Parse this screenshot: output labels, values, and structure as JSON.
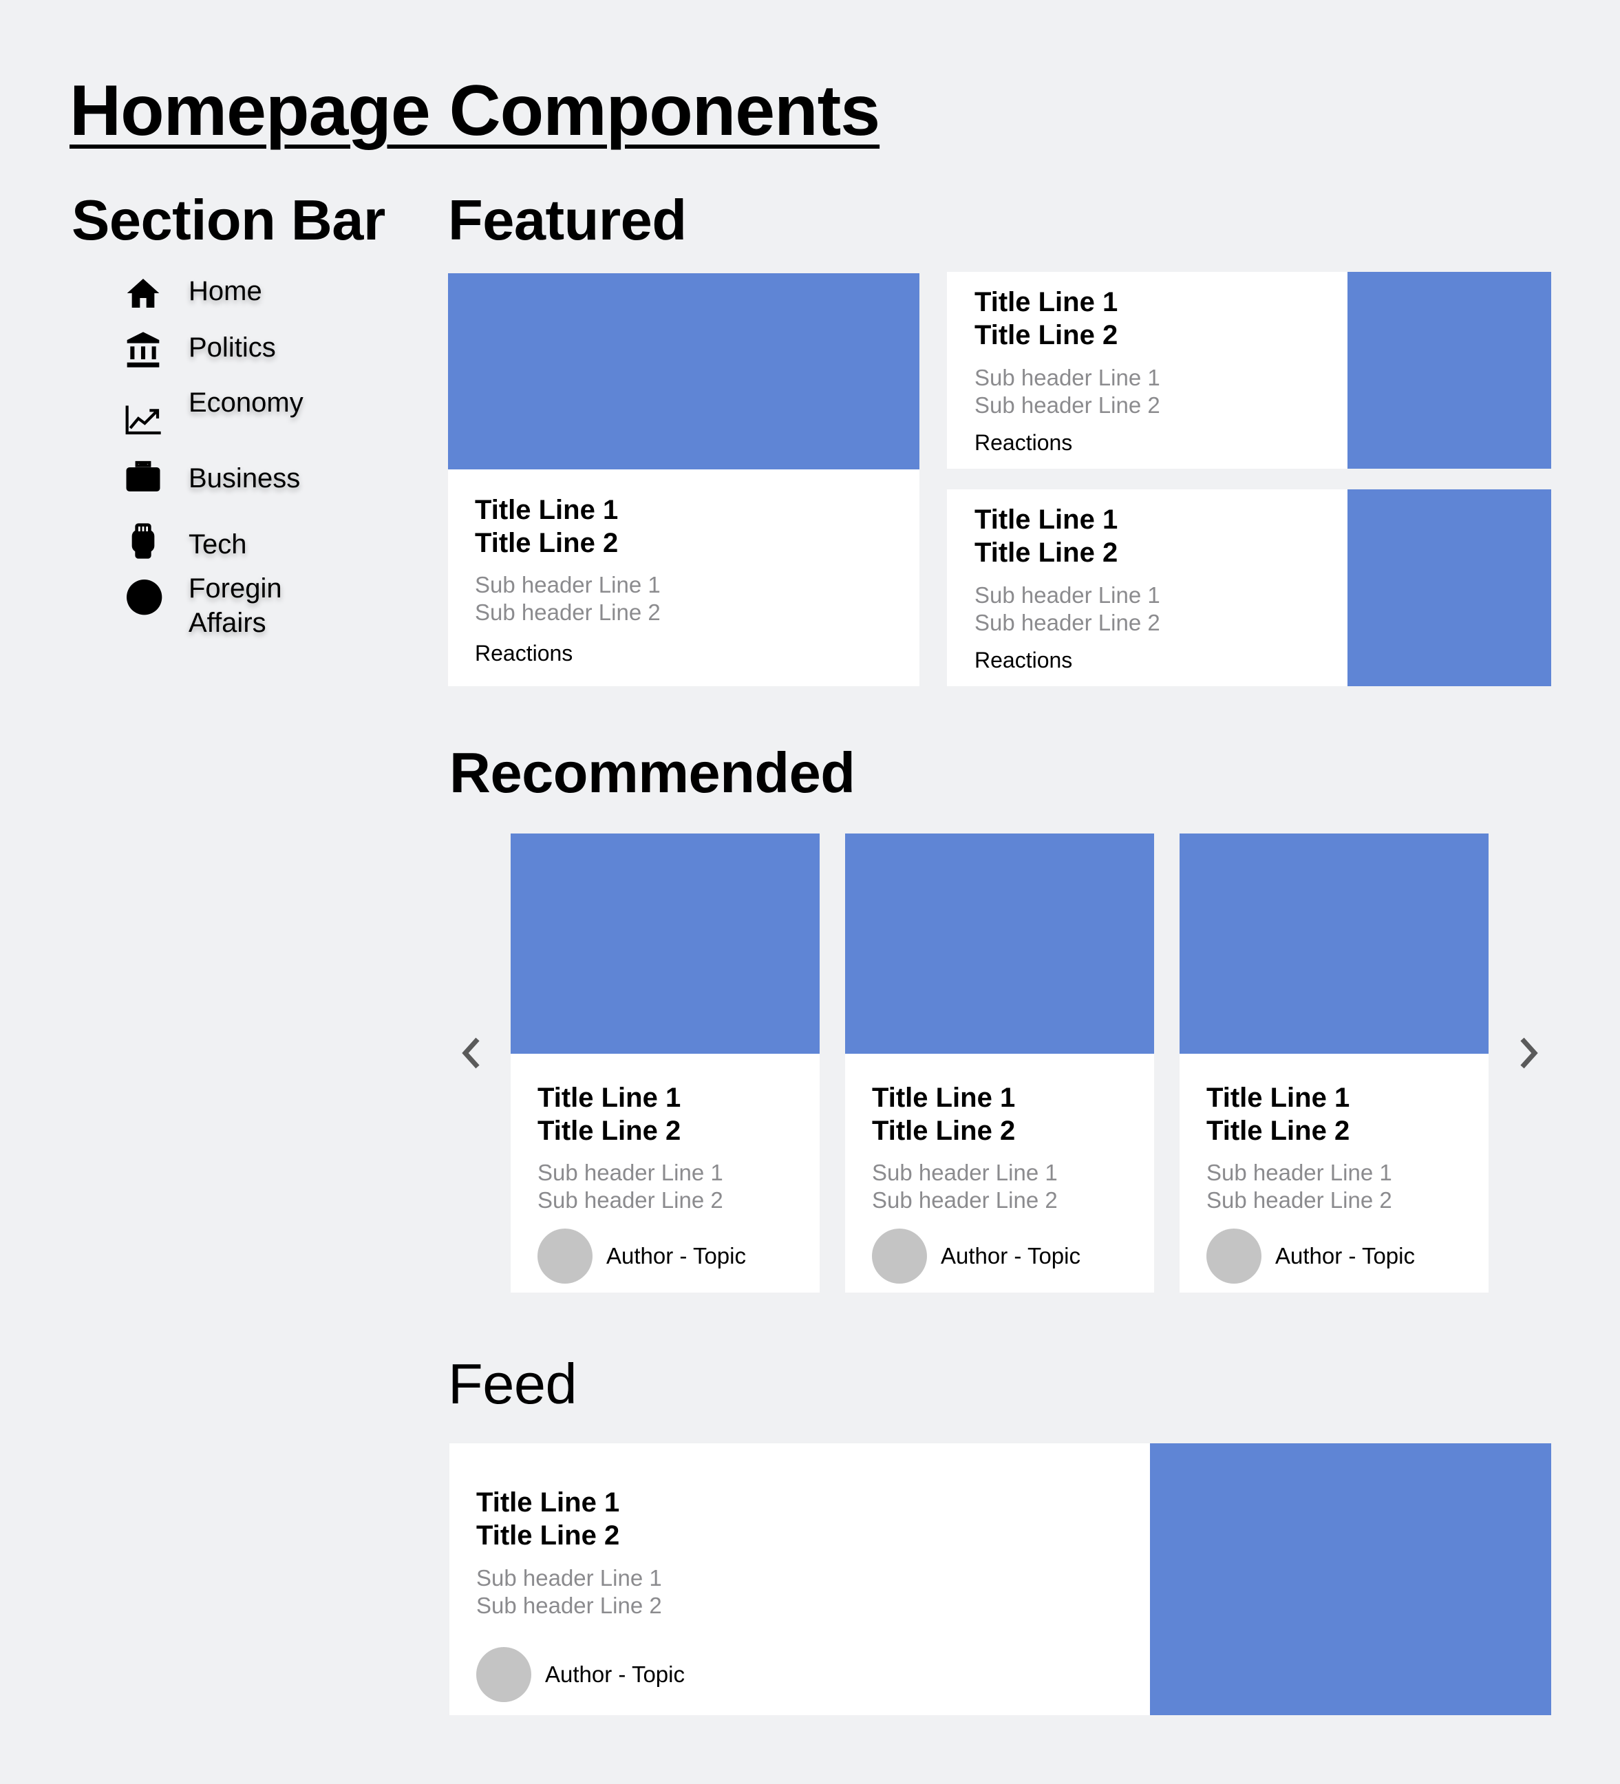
{
  "page_title": "Homepage Components",
  "section_bar": {
    "heading": "Section Bar",
    "items": [
      {
        "label": "Home",
        "icon": "home-icon"
      },
      {
        "label": "Politics",
        "icon": "bank-icon"
      },
      {
        "label": "Economy",
        "icon": "trending-up-icon"
      },
      {
        "label": "Business",
        "icon": "briefcase-icon"
      },
      {
        "label": "Tech",
        "icon": "watch-icon"
      },
      {
        "label": "Foregin",
        "label2": "Affairs",
        "icon": "circle-icon"
      }
    ]
  },
  "featured": {
    "heading": "Featured",
    "main": {
      "title1": "Title Line 1",
      "title2": "Title Line 2",
      "sub1": "Sub header Line 1",
      "sub2": "Sub header Line 2",
      "reactions": "Reactions"
    },
    "side": [
      {
        "title1": "Title Line 1",
        "title2": "Title Line 2",
        "sub1": "Sub header Line 1",
        "sub2": "Sub header Line 2",
        "reactions": "Reactions"
      },
      {
        "title1": "Title Line 1",
        "title2": "Title Line 2",
        "sub1": "Sub header Line 1",
        "sub2": "Sub header Line 2",
        "reactions": "Reactions"
      }
    ]
  },
  "recommended": {
    "heading": "Recommended",
    "cards": [
      {
        "title1": "Title Line 1",
        "title2": "Title Line 2",
        "sub1": "Sub header Line 1",
        "sub2": "Sub header Line 2",
        "byline": "Author - Topic"
      },
      {
        "title1": "Title Line 1",
        "title2": "Title Line 2",
        "sub1": "Sub header Line 1",
        "sub2": "Sub header Line 2",
        "byline": "Author - Topic"
      },
      {
        "title1": "Title Line 1",
        "title2": "Title Line 2",
        "sub1": "Sub header Line 1",
        "sub2": "Sub header Line 2",
        "byline": "Author - Topic"
      }
    ]
  },
  "feed": {
    "heading": "Feed",
    "card": {
      "title1": "Title Line 1",
      "title2": "Title Line 2",
      "sub1": "Sub header Line 1",
      "sub2": "Sub header Line 2",
      "byline": "Author - Topic"
    }
  },
  "colors": {
    "background": "#f0f1f3",
    "image_placeholder": "#5f85d5",
    "subheader": "#8b8b8e",
    "avatar": "#c4c4c4"
  }
}
